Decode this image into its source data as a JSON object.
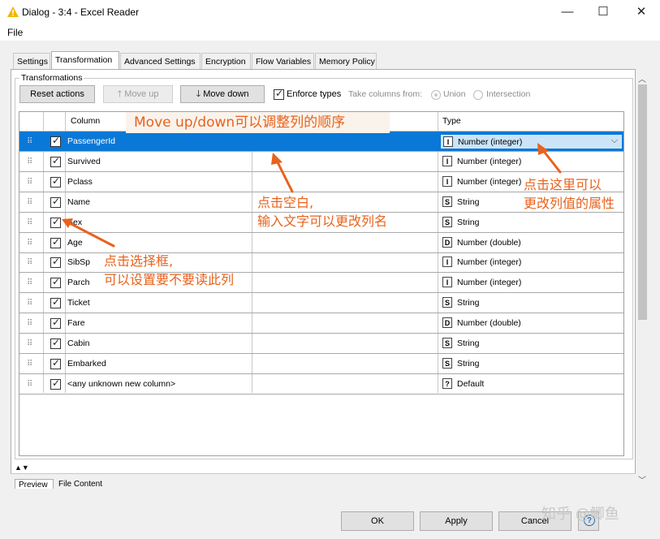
{
  "window": {
    "title": "Dialog - 3:4 - Excel Reader",
    "minimize": "—",
    "maximize": "☐",
    "close": "✕",
    "icon_color": "#f5b400"
  },
  "menu": {
    "file": "File"
  },
  "tabs": [
    {
      "label": "Settings",
      "active": false
    },
    {
      "label": "Transformation",
      "active": true
    },
    {
      "label": "Advanced Settings",
      "active": false
    },
    {
      "label": "Encryption",
      "active": false
    },
    {
      "label": "Flow Variables",
      "active": false
    },
    {
      "label": "Memory Policy",
      "active": false
    }
  ],
  "transformations": {
    "group_title": "Transformations",
    "reset_label": "Reset actions",
    "move_up_label": "Move up",
    "move_down_label": "Move down",
    "enforce_types_label": "Enforce types",
    "enforce_types_checked": true,
    "take_columns_label": "Take columns from:",
    "union_label": "Union",
    "intersection_label": "Intersection"
  },
  "table": {
    "header_column": "Column",
    "header_type": "Type",
    "rows": [
      {
        "name": "PassengerId",
        "badge": "I",
        "type": "Number (integer)",
        "selected": true
      },
      {
        "name": "Survived",
        "badge": "I",
        "type": "Number (integer)"
      },
      {
        "name": "Pclass",
        "badge": "I",
        "type": "Number (integer)"
      },
      {
        "name": "Name",
        "badge": "S",
        "type": "String"
      },
      {
        "name": "Sex",
        "badge": "S",
        "type": "String"
      },
      {
        "name": "Age",
        "badge": "D",
        "type": "Number (double)"
      },
      {
        "name": "SibSp",
        "badge": "I",
        "type": "Number (integer)"
      },
      {
        "name": "Parch",
        "badge": "I",
        "type": "Number (integer)"
      },
      {
        "name": "Ticket",
        "badge": "S",
        "type": "String"
      },
      {
        "name": "Fare",
        "badge": "D",
        "type": "Number (double)"
      },
      {
        "name": "Cabin",
        "badge": "S",
        "type": "String"
      },
      {
        "name": "Embarked",
        "badge": "S",
        "type": "String"
      },
      {
        "name": "<any unknown new column>",
        "badge": "?",
        "type": "Default"
      }
    ]
  },
  "annotations": {
    "move_note": "Move up/down可以调整列的顺序",
    "blank_note_1": "点击空白,",
    "blank_note_2": "输入文字可以更改列名",
    "type_note_1": "点击这里可以",
    "type_note_2": "更改列值的属性",
    "check_note_1": "点击选择框,",
    "check_note_2": "可以设置要不要读此列",
    "color": "#e8621c"
  },
  "bottom_tabs": [
    "Preview",
    "File Content"
  ],
  "buttons": {
    "ok": "OK",
    "apply": "Apply",
    "cancel": "Cancel",
    "help": "?"
  },
  "watermark": "知乎 @鲫鱼"
}
